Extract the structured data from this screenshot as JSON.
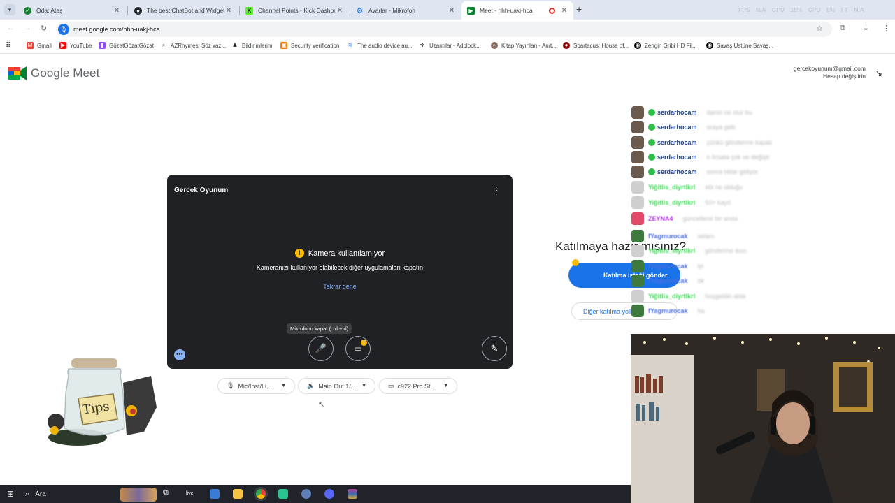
{
  "browser": {
    "tabs": [
      {
        "title": "Oda: Ateş",
        "favicon": "green-shield-icon",
        "color": "#1a7f37"
      },
      {
        "title": "The best ChatBot and Widgets",
        "favicon": "github-icon",
        "color": "#24292f"
      },
      {
        "title": "Channel Points - Kick Dashboar",
        "favicon": "kick-icon",
        "color": "#53fc18"
      },
      {
        "title": "Ayarlar - Mikrofon",
        "favicon": "gear-icon",
        "color": "#1a73e8"
      },
      {
        "title": "Meet - hhh-uakj-hca",
        "favicon": "meet-icon",
        "color": "#00832d",
        "active": true
      }
    ],
    "new_tab": "+",
    "perf_overlay": "FPS N/A   GPU 18%   CPU 8%   FT N/A",
    "url": "meet.google.com/hhh-uakj-hca",
    "bookmarks": [
      {
        "label": "Gmail",
        "icon": "gmail-icon",
        "color": "#ea4335"
      },
      {
        "label": "YouTube",
        "icon": "youtube-icon",
        "color": "#ff0000"
      },
      {
        "label": "GözatGözatGözat",
        "icon": "twitch-icon",
        "color": "#9146ff"
      },
      {
        "label": "AZRhymes: Söz yaz...",
        "icon": "search-icon",
        "color": "#5f6368"
      },
      {
        "label": "Bildirimlerim",
        "icon": "bell-icon",
        "color": "#f4b400"
      },
      {
        "label": "Security verification",
        "icon": "shield-icon",
        "color": "#f57c00"
      },
      {
        "label": "The audio device au...",
        "icon": "audio-icon",
        "color": "#1a73e8"
      },
      {
        "label": "Uzantılar - Adblock...",
        "icon": "puzzle-icon",
        "color": "#3c4043"
      },
      {
        "label": "Kitap Yayınları - Anıt...",
        "icon": "book-icon",
        "color": "#8d6e63"
      },
      {
        "label": "Spartacus: House of...",
        "icon": "spartacus-icon",
        "color": "#8b0000"
      },
      {
        "label": "Zengin Gribi HD Fil...",
        "icon": "film-icon",
        "color": "#000000"
      },
      {
        "label": "Savaş Üstüne Savaş...",
        "icon": "film-icon",
        "color": "#000000"
      }
    ]
  },
  "meet": {
    "logo_text": "Google Meet",
    "account_email": "gercekoyunum@gmail.com",
    "switch_account": "Hesap değiştirin",
    "self_name": "Gercek Oyunum",
    "camera_warning_title": "Kamera kullanılamıyor",
    "camera_warning_body": "Kameranızı kullanıyor olabilecek diğer uygulamaları kapatın",
    "retry": "Tekrar dene",
    "mic_tooltip": "Mikrofonu kapat (ctrl + d)",
    "ready_title": "Katılmaya hazır mısınız?",
    "join_button": "Katılma isteği gönder",
    "other_options": "Diğer katılma yolları",
    "mic_device": "Mic/Inst/Li...",
    "speaker_device": "Main Out 1/...",
    "camera_device": "c922 Pro St..."
  },
  "stream_overlay": {
    "tips_label": "Tips",
    "chat": [
      {
        "user": "serdarhocam",
        "color": "#1c3f8a",
        "verified": true,
        "msg": "damn ne olur bu"
      },
      {
        "user": "serdarhocam",
        "color": "#1c3f8a",
        "verified": true,
        "msg": "oraya gelir"
      },
      {
        "user": "serdarhocam",
        "color": "#1c3f8a",
        "verified": true,
        "msg": "çünkü gönderme kapalı"
      },
      {
        "user": "serdarhocam",
        "color": "#1c3f8a",
        "verified": true,
        "msg": "o fırsata çok ve değişir"
      },
      {
        "user": "serdarhocam",
        "color": "#1c3f8a",
        "verified": true,
        "msg": "sonra tıklar geliyor"
      },
      {
        "user": "Yiğitlis_diyrtlkrl",
        "color": "#3ddc55",
        "verified": false,
        "msg": "ebi ne olduğu"
      },
      {
        "user": "Yiğitlis_diyrtlkrl",
        "color": "#3ddc55",
        "verified": false,
        "msg": "50+ kayıt"
      },
      {
        "user": "ZEYNA4",
        "color": "#b02ee6",
        "verified": false,
        "msg": "güncellenir bir anda"
      },
      {
        "user": "fYagmurocak",
        "color": "#4a6fe3",
        "verified": false,
        "msg": "selam"
      },
      {
        "user": "Yiğitlis_diyrtlkrl",
        "color": "#3ddc55",
        "verified": false,
        "msg": "gönderme ikon"
      },
      {
        "user": "fYagmurocak",
        "color": "#4a6fe3",
        "verified": false,
        "msg": "iyi"
      },
      {
        "user": "fYagmurocak",
        "color": "#4a6fe3",
        "verified": false,
        "msg": "ok"
      },
      {
        "user": "Yiğitlis_diyrtlkrl",
        "color": "#3ddc55",
        "verified": false,
        "msg": "hoşgeldin abla"
      },
      {
        "user": "fYagmurocak",
        "color": "#4a6fe3",
        "verified": false,
        "msg": "ha"
      }
    ]
  },
  "taskbar": {
    "search_placeholder": "Ara"
  },
  "colors": {
    "accent": "#1a73e8",
    "preview_bg": "#202124",
    "warning": "#fbbc04"
  }
}
